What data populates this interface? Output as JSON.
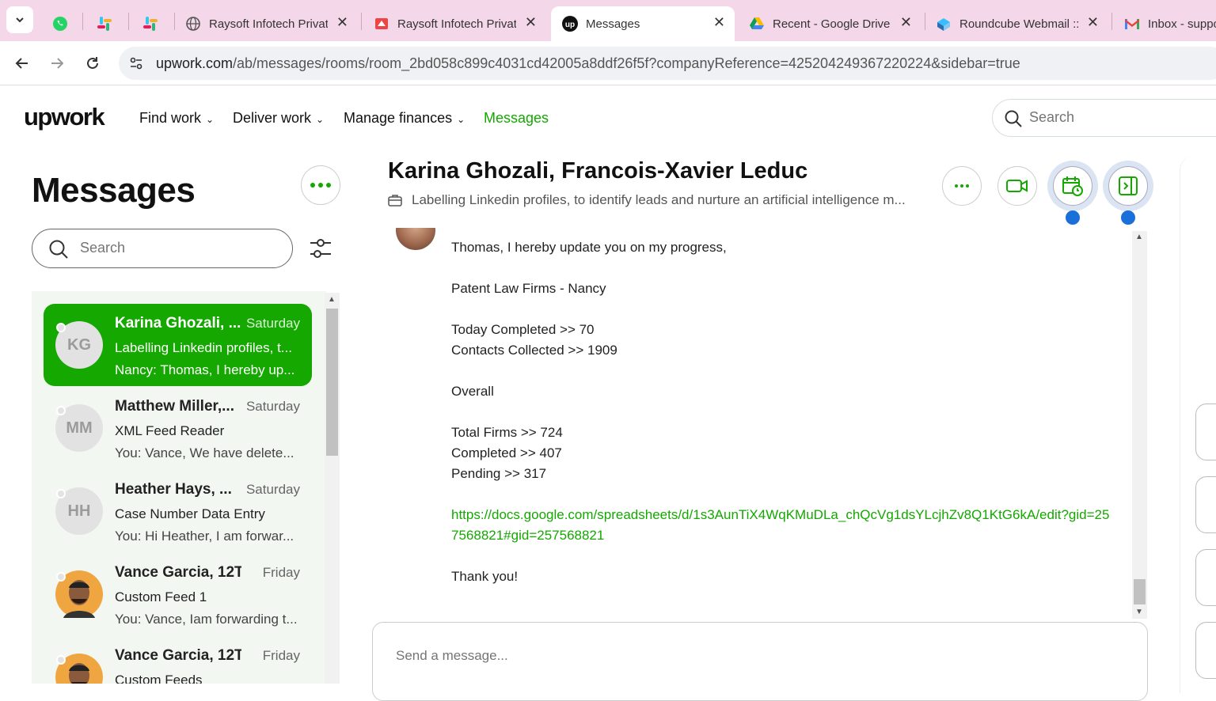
{
  "browser": {
    "tabs": [
      {
        "title": "",
        "icon": "whatsapp-icon"
      },
      {
        "title": "",
        "icon": "slack-icon"
      },
      {
        "title": "",
        "icon": "slack-icon"
      },
      {
        "title": "Raysoft Infotech Privat",
        "icon": "globe-icon"
      },
      {
        "title": "Raysoft Infotech Privat",
        "icon": "raysoft-icon"
      },
      {
        "title": "Messages",
        "icon": "upwork-icon"
      },
      {
        "title": "Recent - Google Drive",
        "icon": "google-drive-icon"
      },
      {
        "title": "Roundcube Webmail ::",
        "icon": "roundcube-icon"
      },
      {
        "title": "Inbox - suppo",
        "icon": "gmail-icon"
      }
    ],
    "url_domain": "upwork.com",
    "url_path": "/ab/messages/rooms/room_2bd058c899c4031cd42005a8ddf26f5f?companyReference=425204249367220224&sidebar=true"
  },
  "header": {
    "logo": "upwork",
    "nav": [
      "Find work",
      "Deliver work",
      "Manage finances",
      "Messages"
    ],
    "search_placeholder": "Search"
  },
  "sidebar": {
    "title": "Messages",
    "search_placeholder": "Search",
    "rooms": [
      {
        "initials": "KG",
        "name": "Karina Ghozali, ...",
        "day": "Saturday",
        "line1": "Labelling Linkedin profiles, t...",
        "line2": "Nancy: Thomas, I hereby up...",
        "active": true
      },
      {
        "initials": "MM",
        "name": "Matthew Miller,...",
        "day": "Saturday",
        "line1": "XML Feed Reader",
        "line2": "You: Vance, We have delete..."
      },
      {
        "initials": "HH",
        "name": "Heather Hays, ...",
        "day": "Saturday",
        "line1": "Case Number Data Entry",
        "line2": "You: Hi Heather, I am forwar..."
      },
      {
        "initials": "",
        "name": "Vance Garcia, 12T...",
        "day": "Friday",
        "line1": "Custom Feed 1",
        "line2": "You: Vance, Iam forwarding t..."
      },
      {
        "initials": "",
        "name": "Vance Garcia, 12T...",
        "day": "Friday",
        "line1": "Custom Feeds",
        "line2": ""
      }
    ]
  },
  "chat": {
    "title": "Karina Ghozali, Francois-Xavier Leduc",
    "subtitle": "Labelling Linkedin profiles, to identify leads and nurture an artificial intelligence m...",
    "message_lines": [
      "Thomas, I hereby update you on my progress,",
      "",
      "Patent Law Firms - Nancy",
      "",
      "Today Completed >> 70",
      "Contacts Collected >> 1909",
      "",
      "Overall",
      "",
      "Total Firms >> 724",
      "Completed >> 407",
      "Pending >> 317",
      ""
    ],
    "link": "https://docs.google.com/spreadsheets/d/1s3AunTiX4WqKMuDLa_chQcVg1dsYLcjhZv8Q1KtG6kA/edit?gid=257568821#gid=257568821",
    "closing": "Thank you!",
    "composer_placeholder": "Send a message..."
  },
  "colors": {
    "brand": "#14a800",
    "tabbar": "#f4d7e8",
    "notify_dot": "#1a6fd8"
  }
}
